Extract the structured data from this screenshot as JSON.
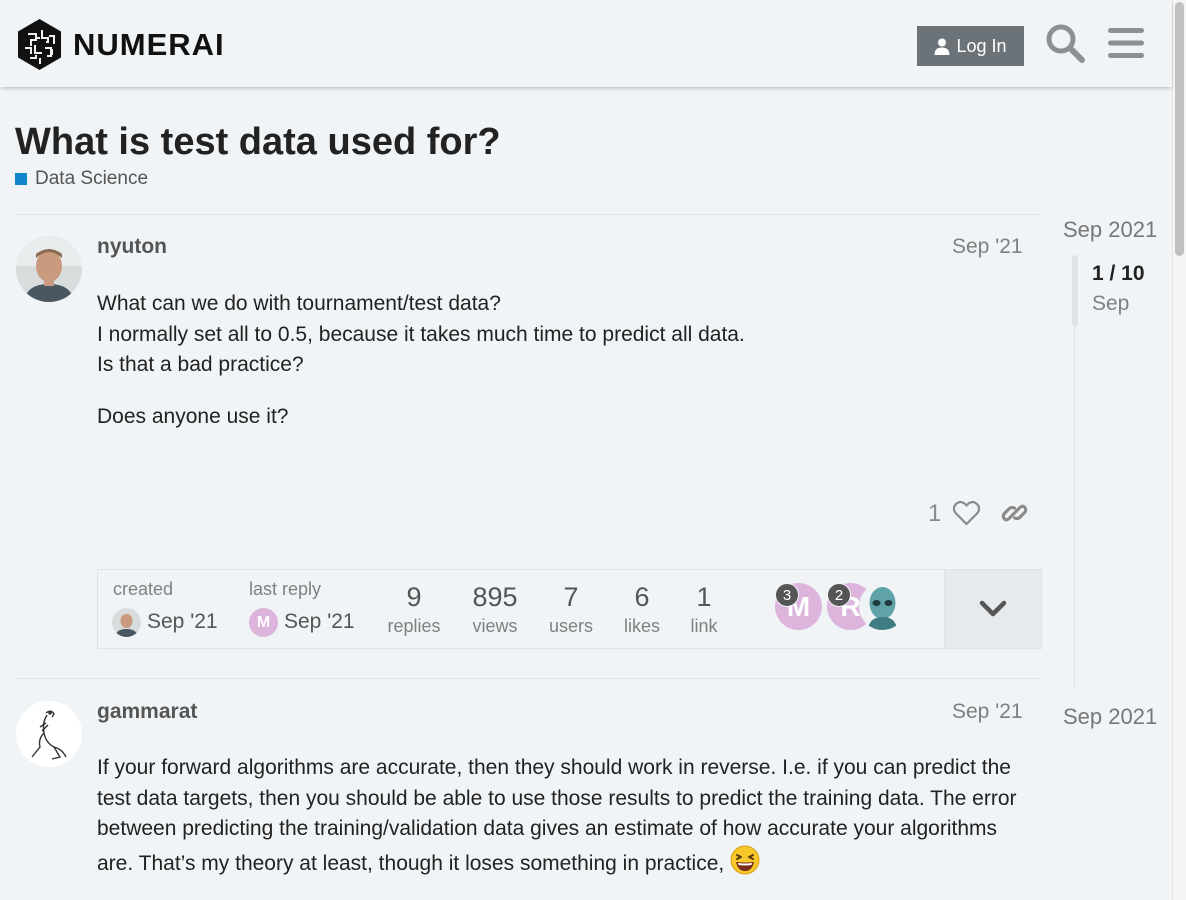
{
  "header": {
    "logo_text": "NUMERAI",
    "login_label": "Log In"
  },
  "topic": {
    "title": "What is test data used for?",
    "category": "Data Science",
    "category_color": "#0e86c9"
  },
  "posts": [
    {
      "username": "nyuton",
      "date": "Sep '21",
      "paragraphs": [
        "What can we do with tournament/test data?\nI normally set all to 0.5, because it takes much time to predict all data.\nIs that a bad practice?",
        "Does anyone use it?"
      ],
      "like_count": "1"
    },
    {
      "username": "gammarat",
      "date": "Sep '21",
      "paragraphs": [
        "If your forward algorithms are accurate, then they should work in reverse. I.e. if you can predict the test data targets, then you should be able to use those results to predict the training data. The error between predicting the training/validation data gives an estimate of how accurate your algorithms are. That’s my theory at least, though it loses something in practice,"
      ]
    }
  ],
  "topic_map": {
    "created_label": "created",
    "created_date": "Sep '21",
    "last_reply_label": "last reply",
    "last_reply_date": "Sep '21",
    "last_reply_initial": "M",
    "stats": [
      {
        "num": "9",
        "label": "replies"
      },
      {
        "num": "895",
        "label": "views"
      },
      {
        "num": "7",
        "label": "users"
      },
      {
        "num": "6",
        "label": "likes"
      },
      {
        "num": "1",
        "label": "link"
      }
    ],
    "participants": [
      {
        "initial": "M",
        "count": "3"
      },
      {
        "initial": "R",
        "count": "2"
      },
      {
        "initial": "",
        "count": ""
      }
    ]
  },
  "timeline": {
    "top_date": "Sep 2021",
    "position": "1 / 10",
    "sub_date": "Sep",
    "bottom_date": "Sep 2021"
  }
}
